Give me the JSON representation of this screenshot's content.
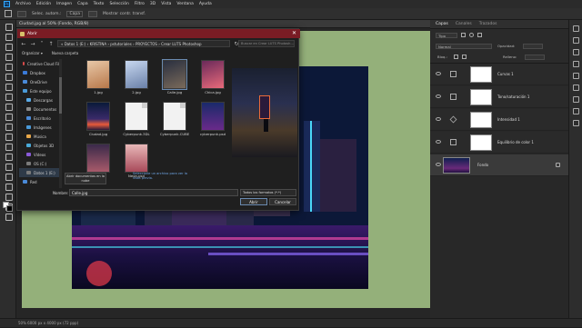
{
  "menubar": {
    "logo": "Ps",
    "items": [
      "Archivo",
      "Edición",
      "Imagen",
      "Capa",
      "Texto",
      "Selección",
      "Filtro",
      "3D",
      "Vista",
      "Ventana",
      "Ayuda"
    ]
  },
  "options": {
    "tool_a": "Selec. autom.:",
    "tool_b": "Capa",
    "tool_c": "Mostrar contr. transf."
  },
  "document": {
    "tab_label": "Ciudad.jpg al 50% (Fondo, RGB/8)"
  },
  "status": {
    "text": "50%   6000 px x 4000 px (72 ppp)"
  },
  "panels": {
    "tabs": [
      "Capas",
      "Canales",
      "Trazados"
    ],
    "active_tab": "Capas",
    "kind_label": "Tipo",
    "blend_mode": "Normal",
    "opacity_label": "Opacidad:",
    "lock_label": "Bloq.:",
    "fill_label": "Relleno:",
    "layers": [
      {
        "name": "Curvas 1",
        "kind": "curves"
      },
      {
        "name": "Tono/saturación 1",
        "kind": "hue"
      },
      {
        "name": "Intensidad 1",
        "kind": "vibrance"
      },
      {
        "name": "Equilibrio de color 1",
        "kind": "balance"
      },
      {
        "name": "Fondo",
        "kind": "image",
        "locked": true
      }
    ]
  },
  "dialog": {
    "title": "Abrir",
    "close": "✕",
    "path": "«  Datos 1 (E:)  ›  KRISTINA  ›  pstutoriales  ›  PROYECTOS  ›  Crear LUTS Photoshop",
    "search_placeholder": "Buscar en Crear LUTS Photosh...",
    "organize": "Organizar ▾",
    "new_folder": "Nueva carpeta",
    "nav": [
      {
        "label": "Creative Cloud Fil",
        "color": "#d84a4a"
      },
      {
        "label": "Dropbox",
        "color": "#3a7ad8"
      },
      {
        "label": "OneDrive",
        "color": "#4a8ad8"
      },
      {
        "label": "Este equipo",
        "color": "#4a9ad8"
      },
      {
        "label": "Descargas",
        "color": "#5aaae8"
      },
      {
        "label": "Documentos",
        "color": "#8a8a8a"
      },
      {
        "label": "Escritorio",
        "color": "#4a8ad8"
      },
      {
        "label": "Imágenes",
        "color": "#4a9ad8"
      },
      {
        "label": "Música",
        "color": "#e8a84a"
      },
      {
        "label": "Objetos 3D",
        "color": "#4aaad8"
      },
      {
        "label": "Vídeos",
        "color": "#8a5ad8"
      },
      {
        "label": "OS (C:)",
        "color": "#7a7a7a"
      },
      {
        "label": "Datos 1 (E:)",
        "color": "#7a7a7a"
      },
      {
        "label": "Red",
        "color": "#4a8ad8"
      }
    ],
    "files": [
      {
        "name": "1.jpg",
        "thumb": "ph1"
      },
      {
        "name": "2.jpg",
        "thumb": "ph2"
      },
      {
        "name": "Calle.jpg",
        "thumb": "ph3",
        "selected": true
      },
      {
        "name": "Chica.jpg",
        "thumb": "ph4"
      },
      {
        "name": "Ciudad.jpg",
        "thumb": "ph5"
      },
      {
        "name": "Cyberpunk.3DL",
        "thumb": "doc"
      },
      {
        "name": "Cyberpunk.CUBE",
        "thumb": "doc"
      },
      {
        "name": "cyberpunk.psd",
        "thumb": "psd"
      },
      {
        "name": "Neon.jpg",
        "thumb": "ph6"
      },
      {
        "name": "Neon.psd",
        "thumb": "ph7"
      }
    ],
    "cloud_button": "Abrir documentos en la nube",
    "hint": "Seleccione un archivo para ver la vista previa.",
    "name_label": "Nombre:",
    "name_value": "Calle.jpg",
    "type_value": "Todos los formatos (*.*)",
    "open_button": "Abrir",
    "cancel_button": "Cancelar"
  }
}
